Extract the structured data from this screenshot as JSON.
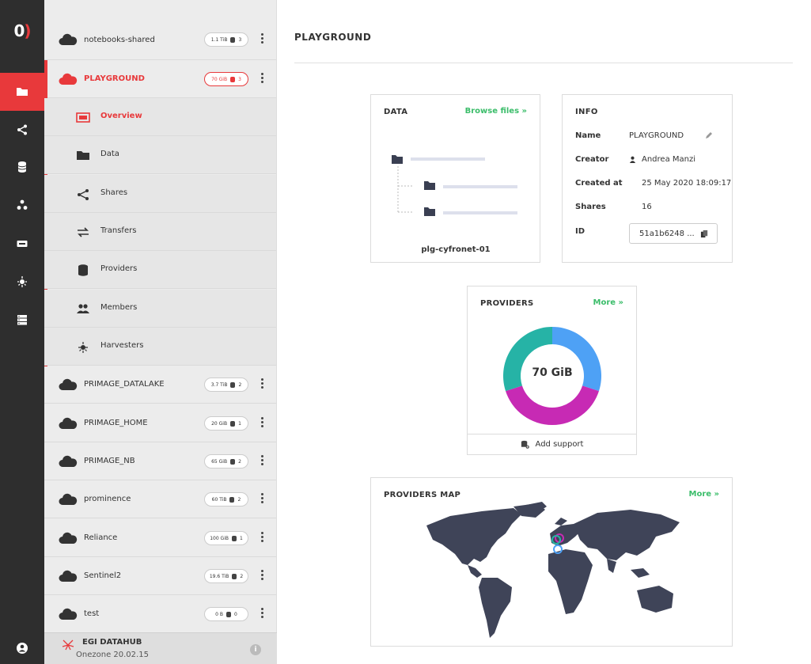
{
  "logo": {
    "text_main": "0",
    "text_accent": ")"
  },
  "rail": {
    "items": [
      "folder-icon",
      "share-icon",
      "database-icon",
      "cluster-icon",
      "token-icon",
      "harvester-icon",
      "server-icon"
    ],
    "active_index": 0
  },
  "sidebar": {
    "spaces": [
      {
        "name": "notebooks-shared",
        "size": "1.1 TiB",
        "providers": "3"
      },
      {
        "name": "PLAYGROUND",
        "size": "70 GiB",
        "providers": "3",
        "active": true
      },
      {
        "name": "PRIMAGE_DATALAKE",
        "size": "3.7 TiB",
        "providers": "2"
      },
      {
        "name": "PRIMAGE_HOME",
        "size": "20 GiB",
        "providers": "1"
      },
      {
        "name": "PRIMAGE_NB",
        "size": "65 GiB",
        "providers": "2"
      },
      {
        "name": "prominence",
        "size": "60 TiB",
        "providers": "2"
      },
      {
        "name": "Reliance",
        "size": "100 GiB",
        "providers": "1"
      },
      {
        "name": "Sentinel2",
        "size": "19.6 TiB",
        "providers": "2"
      },
      {
        "name": "test",
        "size": "0 B",
        "providers": "0"
      }
    ],
    "submenu": [
      {
        "label": "Overview",
        "active": true
      },
      {
        "label": "Data"
      },
      {
        "label": "Shares"
      },
      {
        "label": "Transfers"
      },
      {
        "label": "Providers"
      },
      {
        "label": "Members"
      },
      {
        "label": "Harvesters"
      }
    ],
    "footer": {
      "title": "EGI DATAHUB",
      "version": "Onezone 20.02.15"
    }
  },
  "main": {
    "title": "PLAYGROUND",
    "data_card": {
      "title": "DATA",
      "link": "Browse files »",
      "provider": "plg-cyfronet-01"
    },
    "info_card": {
      "title": "INFO",
      "name_label": "Name",
      "name_value": "PLAYGROUND",
      "creator_label": "Creator",
      "creator_value": "Andrea Manzi",
      "created_label": "Created at",
      "created_value": "25 May 2020 18:09:17",
      "shares_label": "Shares",
      "shares_value": "16",
      "id_label": "ID",
      "id_value": "51a1b6248 ..."
    },
    "providers_card": {
      "title": "PROVIDERS",
      "link": "More »",
      "total": "70 GiB",
      "add_support": "Add support"
    },
    "map_card": {
      "title": "PROVIDERS MAP",
      "link": "More »"
    }
  },
  "chart_data": {
    "type": "pie",
    "categories": [
      "provider-blue",
      "provider-magenta",
      "provider-teal"
    ],
    "values": [
      30,
      40,
      30
    ],
    "colors": [
      "#4ea1f5",
      "#c72ab4",
      "#26b3a6"
    ],
    "center_label": "70 GiB"
  }
}
